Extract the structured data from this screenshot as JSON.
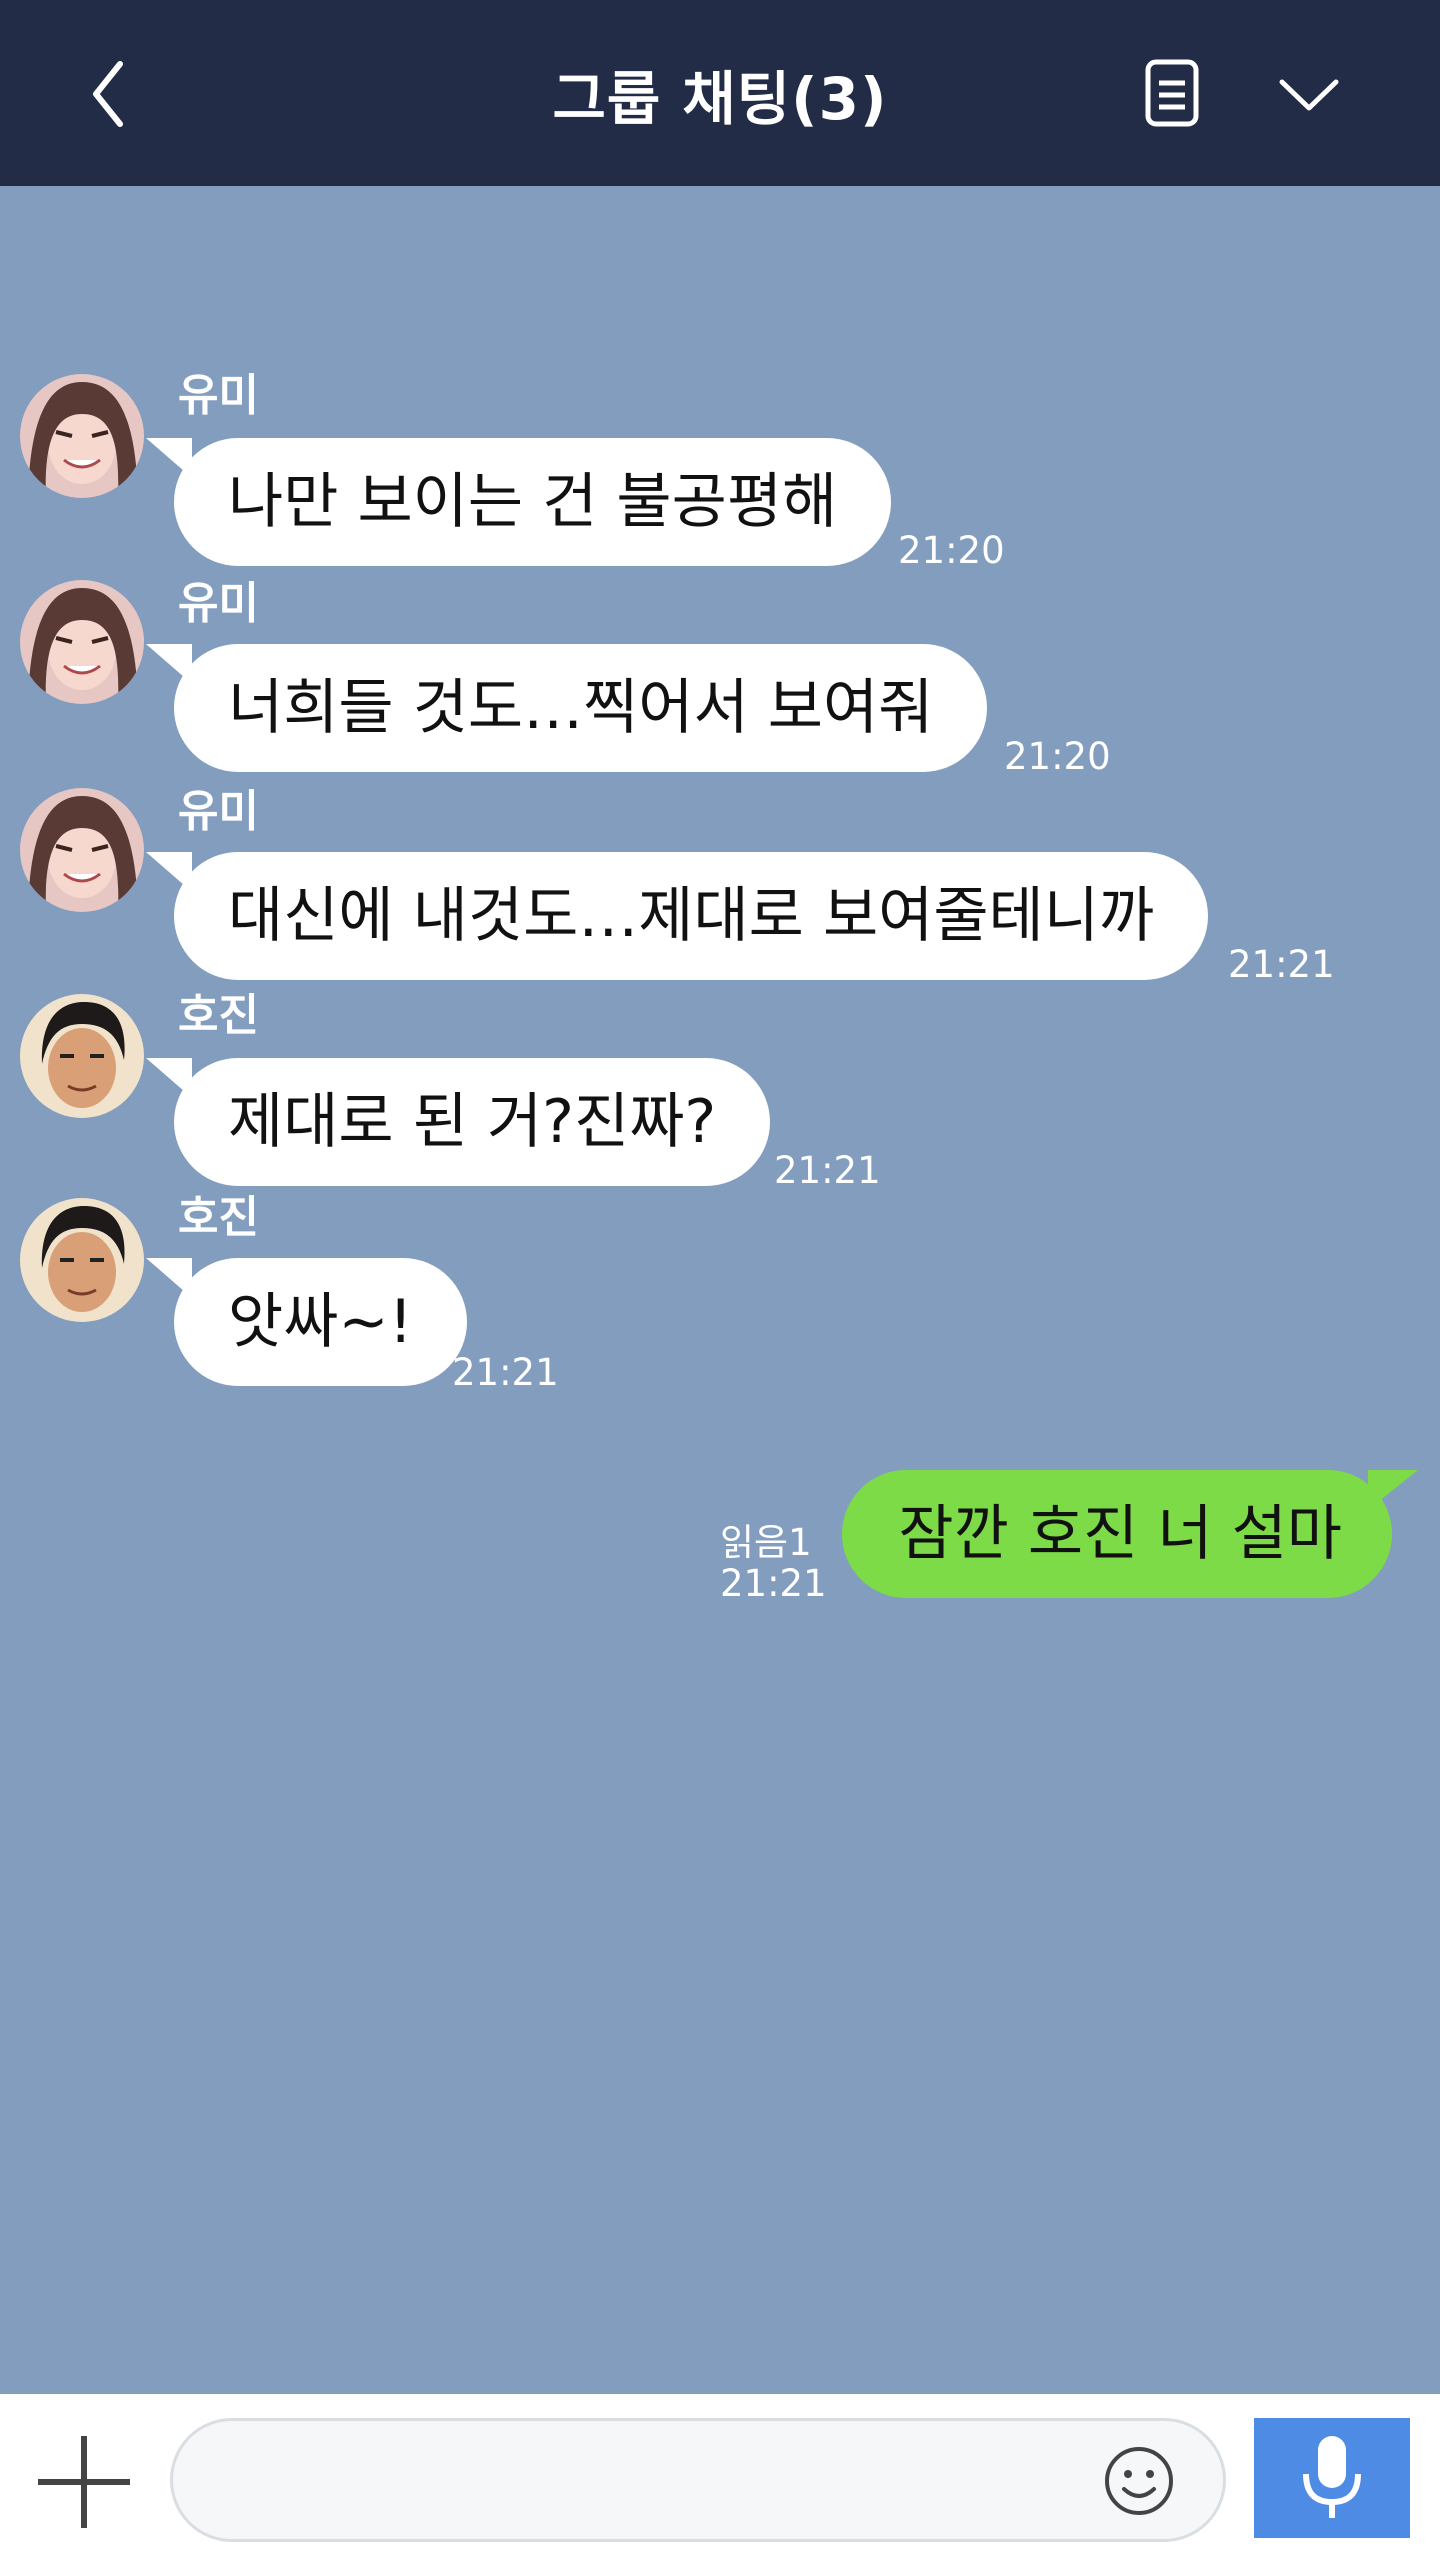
{
  "header": {
    "title": "그룹 채팅(3)",
    "back_icon": "chevron-left-icon",
    "notes_icon": "notes-icon",
    "menu_icon": "chevron-down-icon"
  },
  "messages": [
    {
      "sender": "유미",
      "text": "나만 보이는 건 불공평해",
      "time": "21:20"
    },
    {
      "sender": "유미",
      "text": "너희들 것도…찍어서 보여줘",
      "time": "21:20"
    },
    {
      "sender": "유미",
      "text": "대신에 내것도…제대로 보여줄테니까",
      "time": "21:21"
    },
    {
      "sender": "호진",
      "text": "제대로 된 거?진짜?",
      "time": "21:21"
    },
    {
      "sender": "호진",
      "text": "앗싸~!",
      "time": "21:21"
    }
  ],
  "my_message": {
    "text": "잠깐 호진 너 설마",
    "read_label": "읽음1",
    "time": "21:21"
  },
  "composer": {
    "value": "",
    "plus_icon": "plus-icon",
    "emoji_icon": "emoji-icon",
    "mic_icon": "microphone-icon"
  },
  "colors": {
    "header_bg": "#232c46",
    "chat_bg": "#829dbe",
    "my_bubble": "#7ddb47",
    "mic_button": "#4e8be5"
  }
}
